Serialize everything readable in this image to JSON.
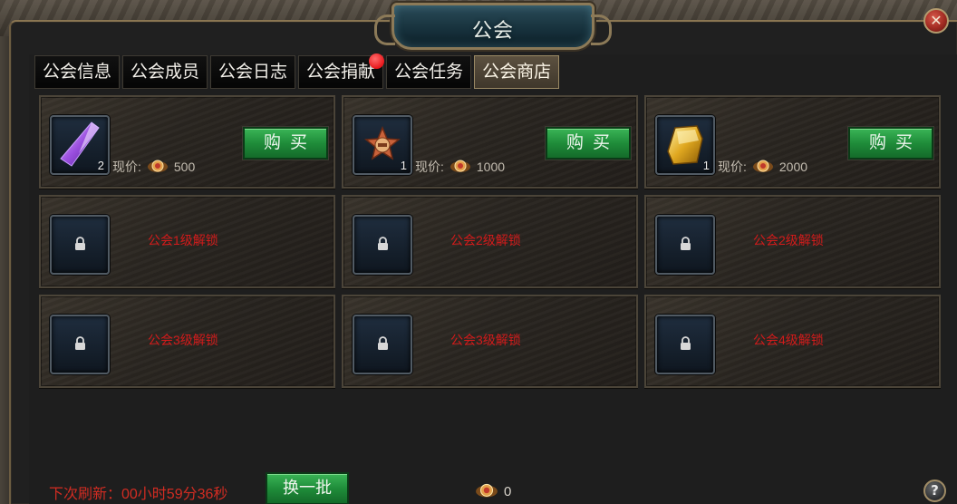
{
  "window": {
    "title": "公会"
  },
  "tabs": [
    {
      "label": "公会信息",
      "active": false,
      "badge": false
    },
    {
      "label": "公会成员",
      "active": false,
      "badge": false
    },
    {
      "label": "公会日志",
      "active": false,
      "badge": false
    },
    {
      "label": "公会捐献",
      "active": false,
      "badge": true
    },
    {
      "label": "公会任务",
      "active": false,
      "badge": false
    },
    {
      "label": "公会商店",
      "active": true,
      "badge": false
    }
  ],
  "shop": {
    "items": [
      {
        "icon": "purple-crystal-icon",
        "qty": "2",
        "price_label": "现价:",
        "price": "500",
        "buy_label": "购买"
      },
      {
        "icon": "bronze-star-medal-icon",
        "qty": "1",
        "price_label": "现价:",
        "price": "1000",
        "buy_label": "购买"
      },
      {
        "icon": "gold-ingot-icon",
        "qty": "1",
        "price_label": "现价:",
        "price": "2000",
        "buy_label": "购买"
      }
    ],
    "locked": [
      {
        "text": "公会1级解锁"
      },
      {
        "text": "公会2级解锁"
      },
      {
        "text": "公会2级解锁"
      },
      {
        "text": "公会3级解锁"
      },
      {
        "text": "公会3级解锁"
      },
      {
        "text": "公会4级解锁"
      }
    ]
  },
  "footer": {
    "refresh_text": "下次刷新：00小时59分36秒",
    "batch_button": "换一批",
    "balance": "0"
  },
  "colors": {
    "buy_green": "#1f8c3a",
    "unlock_red": "#d21b1b",
    "active_tab": "#5c5140"
  }
}
